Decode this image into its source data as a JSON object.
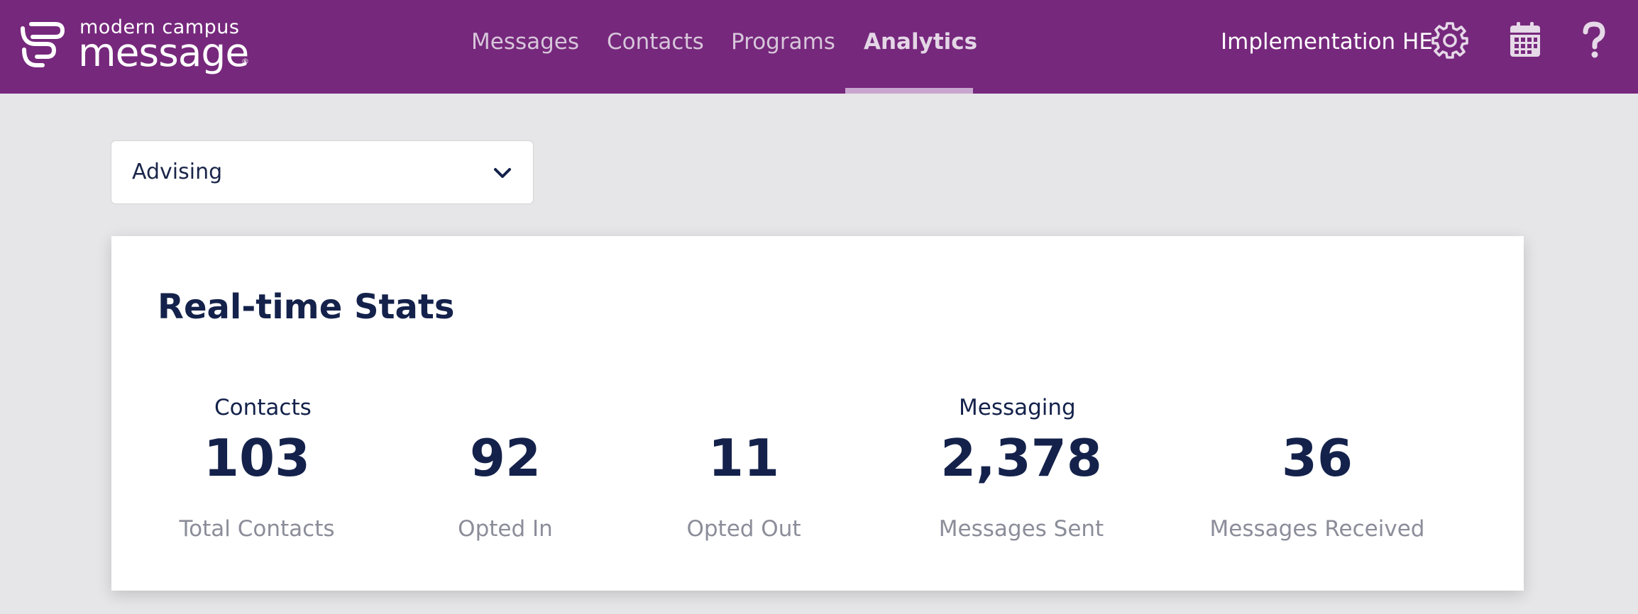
{
  "header": {
    "logo": {
      "line1": "modern campus",
      "line2": "message",
      "registered_mark": "®"
    },
    "nav": [
      {
        "label": "Messages",
        "active": false
      },
      {
        "label": "Contacts",
        "active": false
      },
      {
        "label": "Programs",
        "active": false
      },
      {
        "label": "Analytics",
        "active": true
      }
    ],
    "org_name": "Implementation HE",
    "icons": [
      "gear-icon",
      "calendar-icon",
      "help-icon"
    ]
  },
  "filter": {
    "selected": "Advising",
    "icon": "chevron-down-icon"
  },
  "stats_card": {
    "title": "Real-time Stats",
    "groups": [
      {
        "label": "Contacts"
      },
      {
        "label": "Messaging"
      }
    ],
    "stats": [
      {
        "value": "103",
        "label": "Total Contacts"
      },
      {
        "value": "92",
        "label": "Opted In"
      },
      {
        "value": "11",
        "label": "Opted Out"
      },
      {
        "value": "2,378",
        "label": "Messages Sent"
      },
      {
        "value": "36",
        "label": "Messages Received"
      }
    ]
  },
  "colors": {
    "header_bg": "#76287c",
    "page_bg": "#e6e6e8",
    "primary_text": "#14224b",
    "muted_text": "#8b8d99",
    "nav_active_underline": "#c9a6cf"
  }
}
